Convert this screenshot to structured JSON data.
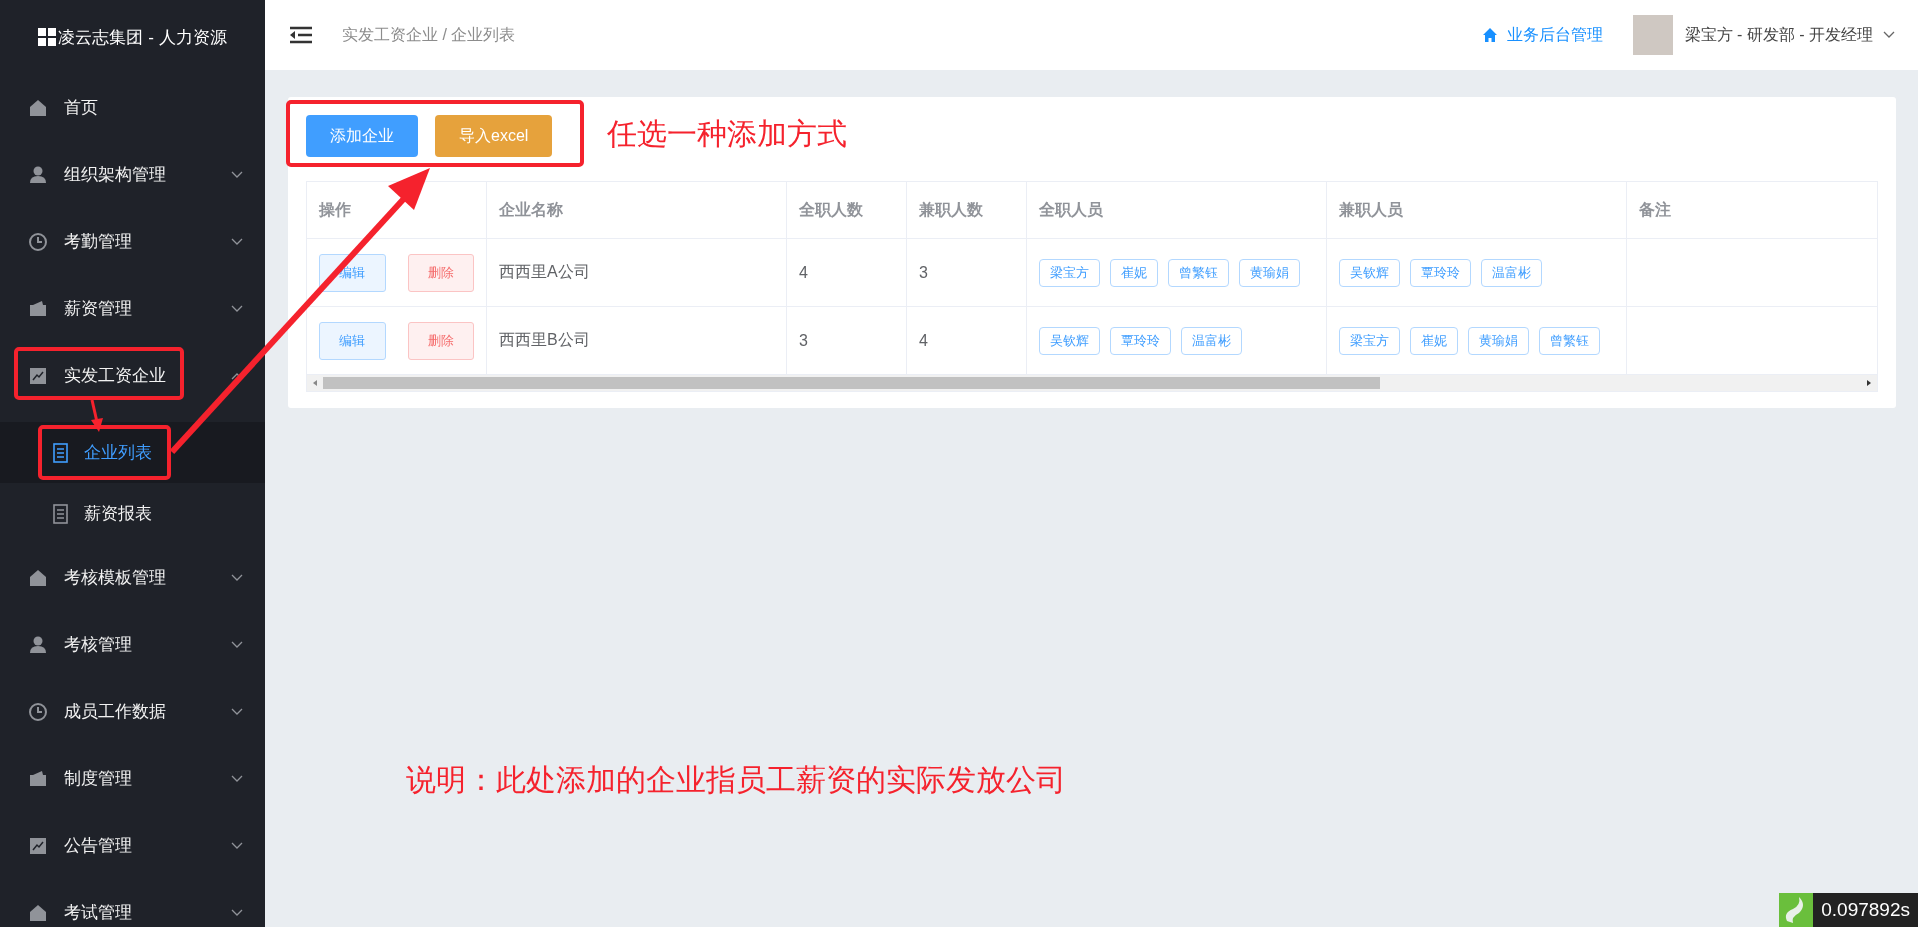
{
  "sidebar": {
    "brand": "凌云志集团 - 人力资源",
    "items": [
      {
        "label": "首页"
      },
      {
        "label": "组织架构管理",
        "expanded": false
      },
      {
        "label": "考勤管理",
        "expanded": false
      },
      {
        "label": "薪资管理",
        "expanded": false
      },
      {
        "label": "实发工资企业",
        "expanded": true,
        "children": [
          {
            "label": "企业列表",
            "selected": true
          },
          {
            "label": "薪资报表",
            "selected": false
          }
        ]
      },
      {
        "label": "考核模板管理",
        "expanded": false
      },
      {
        "label": "考核管理",
        "expanded": false
      },
      {
        "label": "成员工作数据",
        "expanded": false
      },
      {
        "label": "制度管理",
        "expanded": false
      },
      {
        "label": "公告管理",
        "expanded": false
      },
      {
        "label": "考试管理",
        "expanded": false
      }
    ]
  },
  "header": {
    "breadcrumb": "实发工资企业 / 企业列表",
    "backend_link": "业务后台管理",
    "user": "梁宝方 - 研发部 - 开发经理"
  },
  "toolbar": {
    "buttons": [
      {
        "label": "添加企业",
        "kind": "primary"
      },
      {
        "label": "导入excel",
        "kind": "warning"
      }
    ]
  },
  "table": {
    "columns": [
      "操作",
      "企业名称",
      "全职人数",
      "兼职人数",
      "全职人员",
      "兼职人员",
      "备注"
    ],
    "rows": [
      {
        "actions": [
          "编辑",
          "删除"
        ],
        "name": "西西里A公司",
        "fulltime_count": "4",
        "parttime_count": "3",
        "fulltime_staff": [
          "梁宝方",
          "崔妮",
          "曾繁钰",
          "黄瑜娟"
        ],
        "parttime_staff": [
          "吴钦辉",
          "覃玲玲",
          "温富彬"
        ]
      },
      {
        "actions": [
          "编辑",
          "删除"
        ],
        "name": "西西里B公司",
        "fulltime_count": "3",
        "parttime_count": "4",
        "fulltime_staff": [
          "吴钦辉",
          "覃玲玲",
          "温富彬"
        ],
        "parttime_staff": [
          "梁宝方",
          "崔妮",
          "黄瑜娟",
          "曾繁钰"
        ]
      }
    ]
  },
  "annotations": {
    "hint": "任选一种添加方式",
    "note": "说明：此处添加的企业指员工薪资的实际发放公司"
  },
  "timer": "0.097892s"
}
